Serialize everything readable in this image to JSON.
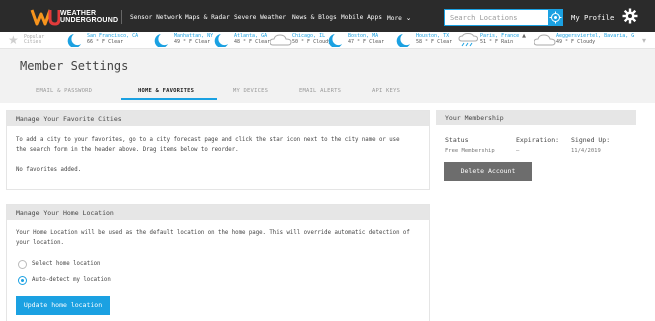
{
  "header": {
    "logo_line1": "WEATHER",
    "logo_line2": "UNDERGROUND",
    "nav": [
      "Sensor Network",
      "Maps & Radar",
      "Severe Weather",
      "News & Blogs",
      "Mobile Apps",
      "More"
    ],
    "search_placeholder": "Search Locations",
    "profile_label": "My Profile"
  },
  "favorites_strip": {
    "popular_line1": "Popular",
    "popular_line2": "Cities",
    "cities": [
      {
        "name": "San Francisco, CA",
        "temp": "66 ° F Clear",
        "icon": "clear-night-icon"
      },
      {
        "name": "Manhattan, NY",
        "temp": "49 ° F Clear",
        "icon": "clear-night-icon"
      },
      {
        "name": "Atlanta, GA",
        "temp": "48 ° F Clear",
        "icon": "clear-night-icon"
      },
      {
        "name": "Chicago, IL",
        "temp": "50 ° F Cloudy",
        "icon": "cloudy-icon"
      },
      {
        "name": "Boston, MA",
        "temp": "47 ° F Clear",
        "icon": "clear-night-icon"
      },
      {
        "name": "Houston, TX",
        "temp": "58 ° F Clear",
        "icon": "clear-night-icon"
      },
      {
        "name": "Paris, France",
        "temp": "51 ° F Rain",
        "icon": "rain-icon"
      },
      {
        "name": "Aeggersviertel, Bavaria, G",
        "temp": "49 ° F Cloudy",
        "icon": "cloudy-icon"
      }
    ]
  },
  "page": {
    "title": "Member Settings",
    "tabs": [
      "EMAIL & PASSWORD",
      "HOME & FAVORITES",
      "MY DEVICES",
      "EMAIL ALERTS",
      "API KEYS"
    ],
    "active_tab": "HOME & FAVORITES"
  },
  "favorites_panel": {
    "title": "Manage Your Favorite Cities",
    "instructions": "To add a city to your favorites, go to a city forecast page and click the star icon next to the city name or use the search form in the header above. Drag items below to reorder.",
    "empty_text": "No favorites added."
  },
  "home_panel": {
    "title": "Manage Your Home Location",
    "description": "Your Home Location will be used as the default location on the home page. This will override automatic detection of your location.",
    "options": [
      {
        "label": "Select home location",
        "selected": false
      },
      {
        "label": "Auto-detect my location",
        "selected": true
      }
    ],
    "button": "Update home location"
  },
  "membership_panel": {
    "title": "Your Membership",
    "headers": [
      "Status",
      "Expiration:",
      "Signed Up:"
    ],
    "values": [
      "Free Membership",
      "–",
      "11/4/2019"
    ],
    "button": "Delete Account"
  },
  "colors": {
    "accent": "#1ba1e2",
    "header_bg": "#2b2b2b",
    "panel_head": "#e6e6e6"
  }
}
